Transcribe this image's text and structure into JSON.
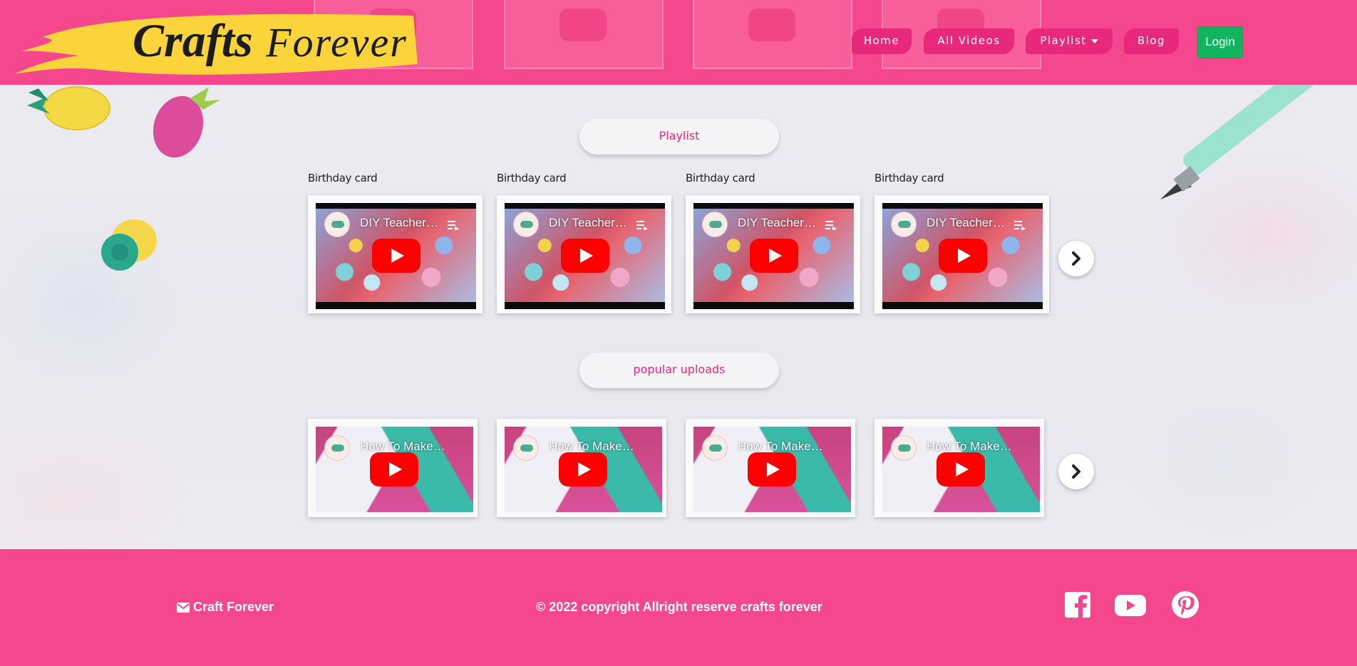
{
  "brand": {
    "logo_word1": "Crafts",
    "logo_word2": "Forever",
    "accent_color": "#f5478d",
    "brush_color": "#fbd33b"
  },
  "nav": {
    "items": [
      {
        "label": "Home"
      },
      {
        "label": "All Videos"
      },
      {
        "label": "Playlist"
      },
      {
        "label": "Blog"
      }
    ],
    "login_label": "Login"
  },
  "sections": {
    "playlist": {
      "heading": "Playlist",
      "cards": [
        {
          "title": "Birthday card",
          "video_title": "DIY Teacher's Day Card"
        },
        {
          "title": "Birthday card",
          "video_title": "DIY Teacher's Day Card"
        },
        {
          "title": "Birthday card",
          "video_title": "DIY Teacher's Day Card"
        },
        {
          "title": "Birthday card",
          "video_title": "DIY Teacher's Day Card"
        }
      ]
    },
    "popular": {
      "heading": "popular uploads",
      "cards": [
        {
          "video_title": "How To Make A..."
        },
        {
          "video_title": "How To Make A..."
        },
        {
          "video_title": "How To Make A..."
        },
        {
          "video_title": "How To Make A..."
        }
      ]
    }
  },
  "footer": {
    "brand": "Craft Forever",
    "copyright": "© 2022 copyright Allright reserve crafts forever",
    "social": [
      "facebook-icon",
      "youtube-icon",
      "pinterest-icon"
    ]
  }
}
